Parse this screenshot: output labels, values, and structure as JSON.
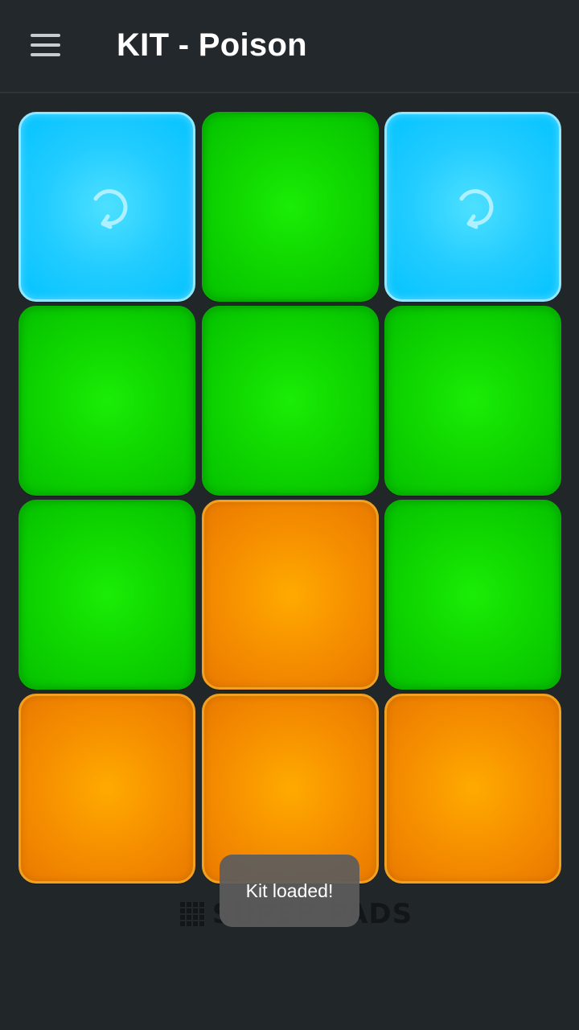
{
  "header": {
    "title": "KIT - Poison",
    "menu_icon": "hamburger-menu-icon"
  },
  "pads": [
    {
      "color": "blue",
      "icon": "loop-icon"
    },
    {
      "color": "green"
    },
    {
      "color": "blue",
      "icon": "loop-icon"
    },
    {
      "color": "green"
    },
    {
      "color": "green"
    },
    {
      "color": "green"
    },
    {
      "color": "green"
    },
    {
      "color": "orange"
    },
    {
      "color": "green"
    },
    {
      "color": "orange"
    },
    {
      "color": "orange"
    },
    {
      "color": "orange"
    }
  ],
  "colors": {
    "green": "#10d800",
    "orange": "#f58d00",
    "blue": "#22ccff",
    "background": "#212629"
  },
  "brand": {
    "text": "SUPER PADS",
    "icon": "grid-logo-icon"
  },
  "toast": {
    "message": "Kit loaded!"
  }
}
